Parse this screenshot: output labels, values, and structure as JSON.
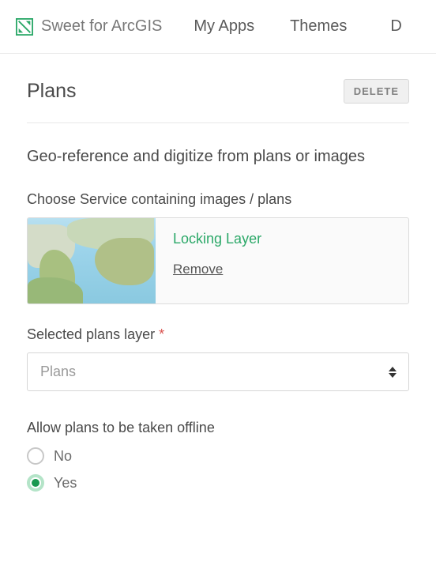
{
  "header": {
    "brand": "Sweet for ArcGIS",
    "nav": [
      "My Apps",
      "Themes",
      "D"
    ]
  },
  "page": {
    "title": "Plans",
    "delete_label": "DELETE",
    "subtitle": "Geo-reference and digitize from plans or images"
  },
  "service": {
    "label": "Choose Service containing images / plans",
    "name": "Locking Layer",
    "remove_label": "Remove"
  },
  "layer": {
    "label": "Selected plans layer",
    "required_mark": "*",
    "selected": "Plans"
  },
  "offline": {
    "label": "Allow plans to be taken offline",
    "options": {
      "no": "No",
      "yes": "Yes"
    },
    "selected": "yes"
  }
}
